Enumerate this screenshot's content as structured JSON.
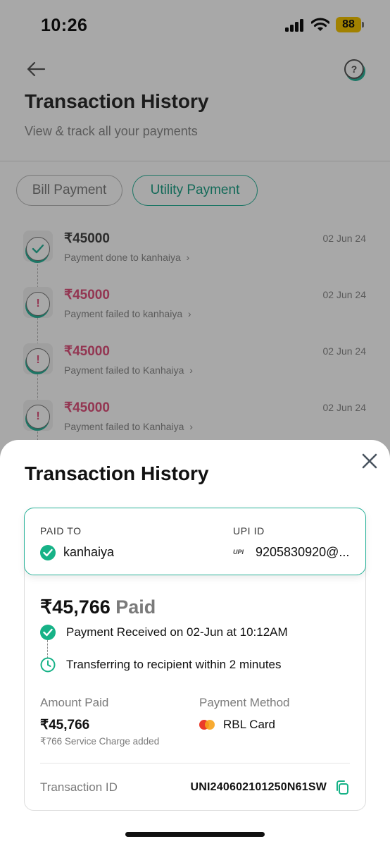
{
  "status_bar": {
    "time": "10:26",
    "battery": "88"
  },
  "header": {
    "title": "Transaction History",
    "subtitle": "View & track all your payments"
  },
  "filters": [
    {
      "label": "Bill Payment",
      "active": false
    },
    {
      "label": "Utility Payment",
      "active": true
    }
  ],
  "transactions": [
    {
      "amount": "₹45000",
      "description": "Payment done to kanhaiya",
      "date": "02 Jun 24",
      "status": "success"
    },
    {
      "amount": "₹45000",
      "description": "Payment failed to kanhaiya",
      "date": "02 Jun 24",
      "status": "failed"
    },
    {
      "amount": "₹45000",
      "description": "Payment failed to Kanhaiya",
      "date": "02 Jun 24",
      "status": "failed"
    },
    {
      "amount": "₹45000",
      "description": "Payment failed to Kanhaiya",
      "date": "02 Jun 24",
      "status": "failed"
    }
  ],
  "sheet": {
    "title": "Transaction History",
    "paid_to_label": "PAID TO",
    "payee_name": "kanhaiya",
    "upi_label": "UPI ID",
    "upi_logo": "UPI",
    "upi_id": "9205830920@...",
    "amount": "₹45,766",
    "amount_status": "Paid",
    "status_steps": [
      "Payment Received on 02-Jun at 10:12AM",
      "Transferring to recipient within 2 minutes"
    ],
    "amount_paid_label": "Amount Paid",
    "amount_paid_value": "₹45,766",
    "service_charge": "₹766 Service Charge added",
    "payment_method_label": "Payment Method",
    "payment_method_value": "RBL Card",
    "transaction_id_label": "Transaction ID",
    "transaction_id_value": "UNI240602101250N61SW"
  },
  "colors": {
    "accent": "#2bb39a",
    "success": "#17b287",
    "failed": "#e0527d",
    "battery": "#f5c400"
  }
}
